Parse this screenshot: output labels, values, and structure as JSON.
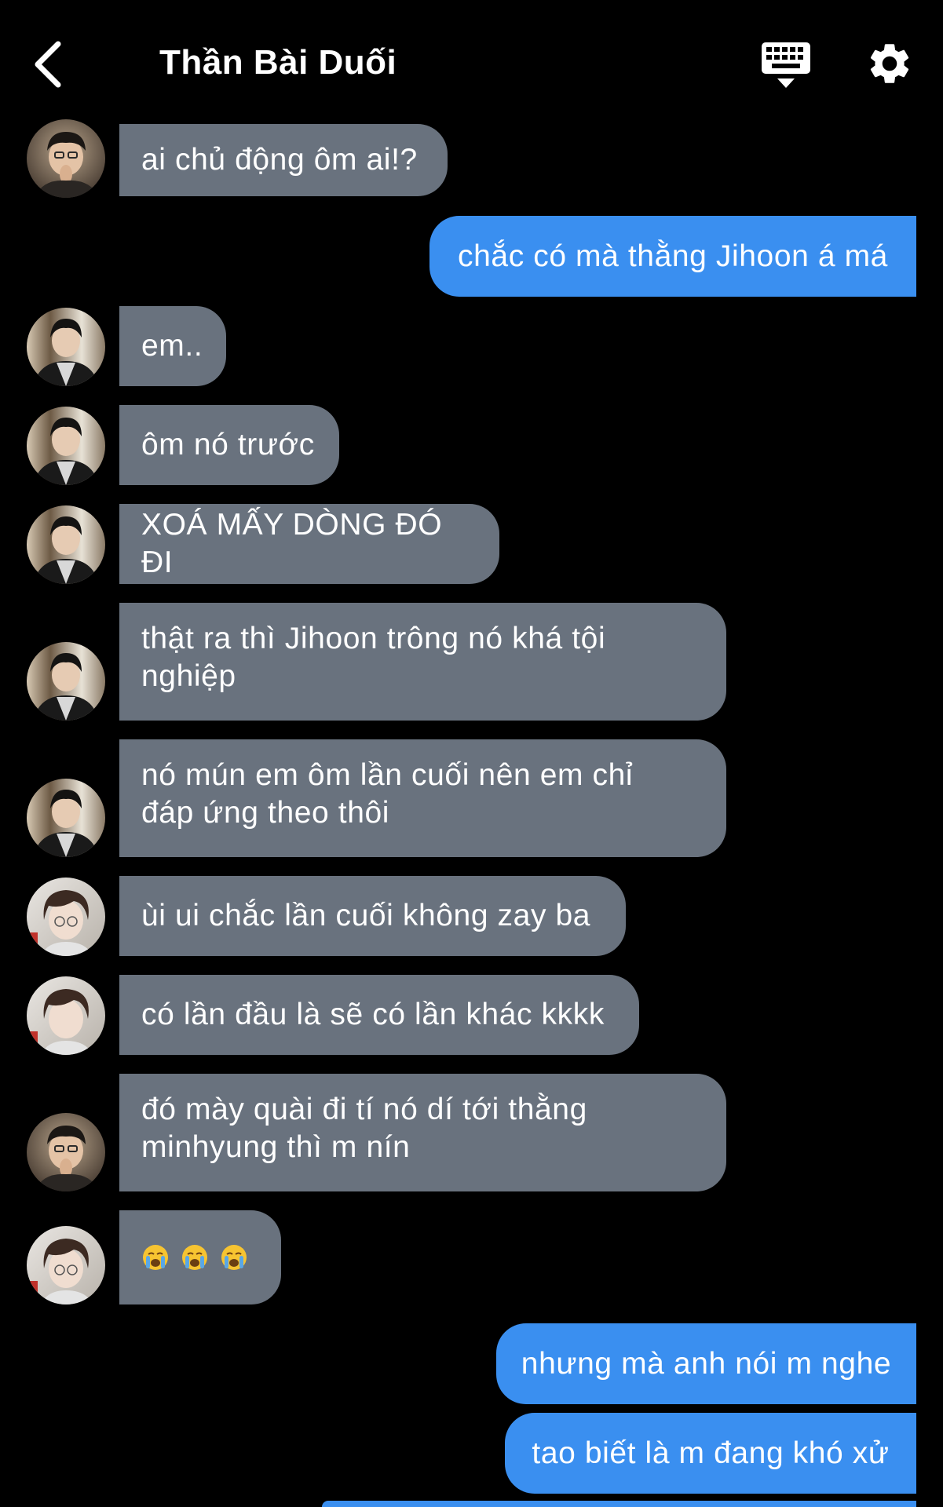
{
  "header": {
    "title": "Thần Bài Duối",
    "back_icon": "chevron-left-icon",
    "keyboard_icon": "keyboard-icon",
    "settings_icon": "gear-icon"
  },
  "colors": {
    "background": "#000000",
    "incoming_bubble": "#69727e",
    "outgoing_bubble": "#3a8ff0",
    "text": "#ffffff"
  },
  "messages": [
    {
      "side": "in",
      "text": "ai chủ động ôm ai!?",
      "avatar": "avatar-a"
    },
    {
      "side": "out",
      "text": "chắc có mà thằng Jihoon á má"
    },
    {
      "side": "in",
      "text": "em..",
      "avatar": "avatar-b"
    },
    {
      "side": "in",
      "text": "ôm nó trước",
      "avatar": "avatar-b"
    },
    {
      "side": "in",
      "text": "XOÁ MẤY DÒNG ĐÓ ĐI",
      "avatar": "avatar-b"
    },
    {
      "side": "in",
      "lines": [
        "thật ra thì Jihoon trông nó khá tội",
        "nghiệp"
      ],
      "avatar": "avatar-b"
    },
    {
      "side": "in",
      "lines": [
        "nó mún em ôm lần cuối nên em chỉ",
        "đáp ứng theo thôi"
      ],
      "avatar": "avatar-b"
    },
    {
      "side": "in",
      "text": "ùi ui chắc lần cuối không zay ba",
      "avatar": "avatar-c"
    },
    {
      "side": "in",
      "text": "có lần đầu là sẽ có lần khác kkkk",
      "avatar": "avatar-c"
    },
    {
      "side": "in",
      "lines": [
        "đó mày quài đi tí nó dí tới thằng",
        "minhyung thì m nín"
      ],
      "avatar": "avatar-a"
    },
    {
      "side": "in",
      "emoji": [
        "crying-face-icon",
        "crying-face-icon",
        "crying-face-icon"
      ],
      "avatar": "avatar-c"
    },
    {
      "side": "out",
      "text": "nhưng mà anh nói m nghe"
    },
    {
      "side": "out",
      "text": "tao biết là m đang khó xử"
    }
  ]
}
